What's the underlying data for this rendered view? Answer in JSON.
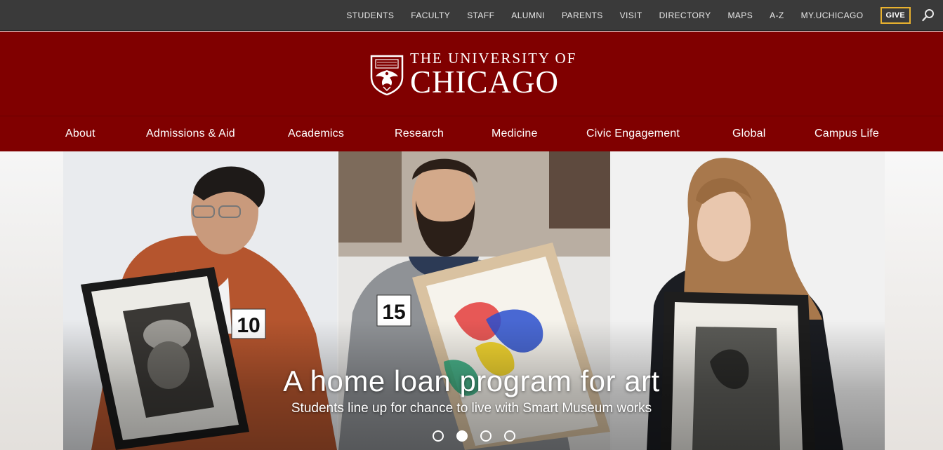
{
  "utility_nav": {
    "links": [
      "STUDENTS",
      "FACULTY",
      "STAFF",
      "ALUMNI",
      "PARENTS",
      "VISIT",
      "DIRECTORY",
      "MAPS",
      "A-Z",
      "MY.UCHICAGO"
    ],
    "give_label": "GIVE",
    "search_icon": "search-icon"
  },
  "brand": {
    "line1": "THE UNIVERSITY OF",
    "line2": "CHICAGO",
    "logo_icon": "phoenix-shield-icon"
  },
  "main_nav": {
    "items": [
      "About",
      "Admissions & Aid",
      "Academics",
      "Research",
      "Medicine",
      "Civic Engagement",
      "Global",
      "Campus Life"
    ]
  },
  "hero": {
    "headline": "A home loan program for art",
    "subhead": "Students line up for chance to live with Smart Museum works",
    "slide_count": 4,
    "active_slide": 2,
    "badges": [
      "10",
      "15"
    ]
  },
  "colors": {
    "maroon": "#800000",
    "utility_bg": "#3a3a3a",
    "give_border": "#e9b22f"
  }
}
